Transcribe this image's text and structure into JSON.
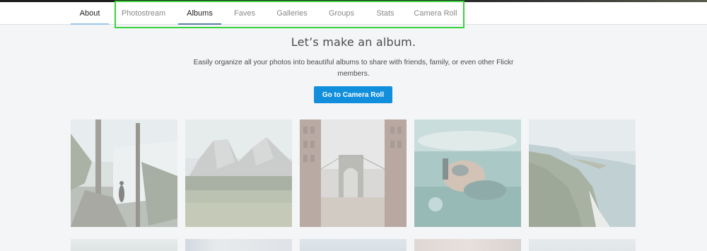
{
  "nav": {
    "items": [
      {
        "label": "About",
        "active": true
      },
      {
        "label": "Photostream",
        "active": false
      },
      {
        "label": "Albums",
        "active": true
      },
      {
        "label": "Faves",
        "active": false
      },
      {
        "label": "Galleries",
        "active": false
      },
      {
        "label": "Groups",
        "active": false
      },
      {
        "label": "Stats",
        "active": false
      },
      {
        "label": "Camera Roll",
        "active": false
      }
    ],
    "underline_colors": {
      "about": "#9ac6e7",
      "albums": "#5a7fa6"
    }
  },
  "empty_state": {
    "title": "Let’s make an album.",
    "description": "Easily organize all your photos into beautiful albums to share with friends, family, or even other Flickr members.",
    "cta_label": "Go to Camera Roll"
  },
  "colors": {
    "accent": "#128fdc",
    "page_background": "#f3f5f6",
    "highlight_box": "#39d33c"
  },
  "gallery": {
    "images": [
      {
        "subject": "forest-hiker-waterfall"
      },
      {
        "subject": "yosemite-half-dome-meadow"
      },
      {
        "subject": "brooklyn-manhattan-bridge"
      },
      {
        "subject": "underwater-snorkeler"
      },
      {
        "subject": "coastal-cliffs-bigsur"
      }
    ]
  }
}
